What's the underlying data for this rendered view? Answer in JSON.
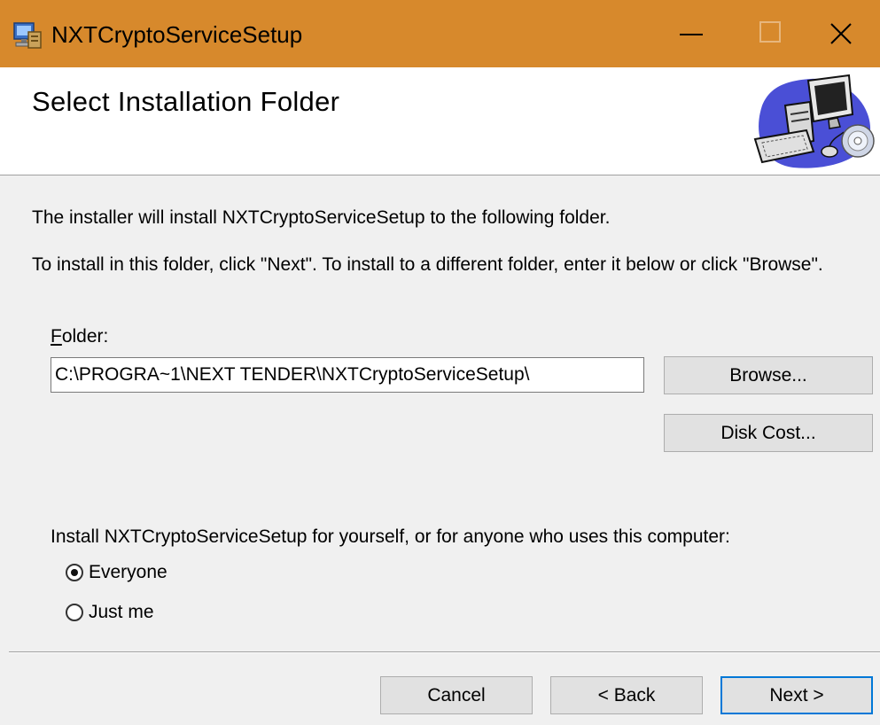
{
  "window": {
    "title": "NXTCryptoServiceSetup",
    "title_bar_color": "#d7892c",
    "controls": {
      "minimize_icon": "minimize-icon",
      "maximize_icon": "maximize-icon",
      "close_icon": "close-icon"
    }
  },
  "header": {
    "title": "Select Installation Folder",
    "graphic": "computer-with-disc-icon"
  },
  "body": {
    "intro_line1": "The installer will install NXTCryptoServiceSetup to the following folder.",
    "intro_line2": "To install in this folder, click \"Next\". To install to a different folder, enter it below or click \"Browse\".",
    "folder_label_accel": "F",
    "folder_label_rest": "older:",
    "folder_value": "C:\\PROGRA~1\\NEXT TENDER\\NXTCryptoServiceSetup\\",
    "browse_label": "Browse...",
    "disk_cost_label": "Disk Cost...",
    "scope_question": "Install NXTCryptoServiceSetup for yourself, or for anyone who uses this computer:",
    "scope_options": [
      {
        "label": "Everyone",
        "selected": true
      },
      {
        "label": "Just me",
        "selected": false
      }
    ]
  },
  "footer": {
    "cancel_label": "Cancel",
    "back_label": "< Back",
    "next_label": "Next >",
    "default_button_color": "#0078d7"
  }
}
